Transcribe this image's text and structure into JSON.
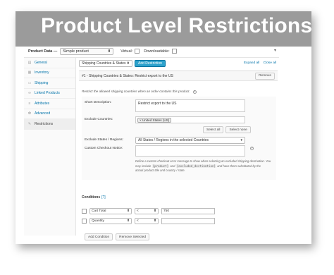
{
  "banner": {
    "title": "Product Level Restrictions"
  },
  "product_bar": {
    "label": "Product Data —",
    "type_value": "Simple product",
    "virtual_label": "Virtual:",
    "downloadable_label": "Downloadable:"
  },
  "sidebar": {
    "items": [
      {
        "label": "General",
        "icon": "gear-icon"
      },
      {
        "label": "Inventory",
        "icon": "inventory-icon"
      },
      {
        "label": "Shipping",
        "icon": "truck-icon"
      },
      {
        "label": "Linked Products",
        "icon": "link-icon"
      },
      {
        "label": "Attributes",
        "icon": "list-icon"
      },
      {
        "label": "Advanced",
        "icon": "settings-icon"
      },
      {
        "label": "Restrictions",
        "icon": "wrench-icon"
      }
    ]
  },
  "toolbar": {
    "restriction_type": "Shipping Countries & States",
    "add_button": "Add Restriction",
    "expand_all": "Expand all",
    "close_all": "Close all"
  },
  "panel": {
    "heading": "#1 - Shipping Countries & States: Restrict export to the US",
    "remove_button": "Remove",
    "intro": "Restrict the allowed shipping countries when an order contains this product.",
    "short_description_label": "Short Description:",
    "short_description_value": "Restrict export to the US",
    "exclude_countries_label": "Exclude Countries:",
    "excluded_country_chip": "United States (US)",
    "select_all": "Select all",
    "select_none": "Select none",
    "exclude_states_label": "Exclude States / Regions:",
    "exclude_states_value": "All States / Regions in the selected Countries",
    "custom_notice_label": "Custom Checkout Notice:",
    "note_line1": "Define a custom checkout error message to show when selecting an excluded shipping destination. You",
    "note_line2_a": "may include",
    "note_code1": "{product}",
    "note_line2_b": "and",
    "note_code2": "{excluded_destination}",
    "note_line2_c": "and have them substituted by the",
    "note_line3": "actual product title and country / state."
  },
  "conditions": {
    "title": "Conditions",
    "help_link": "[?]",
    "rows": [
      {
        "field": "Cart Total",
        "operator": "<",
        "value": "750"
      },
      {
        "field": "Quantity",
        "operator": "<",
        "value": ""
      }
    ],
    "add_button": "Add Condition",
    "remove_button": "Remove Selected"
  }
}
